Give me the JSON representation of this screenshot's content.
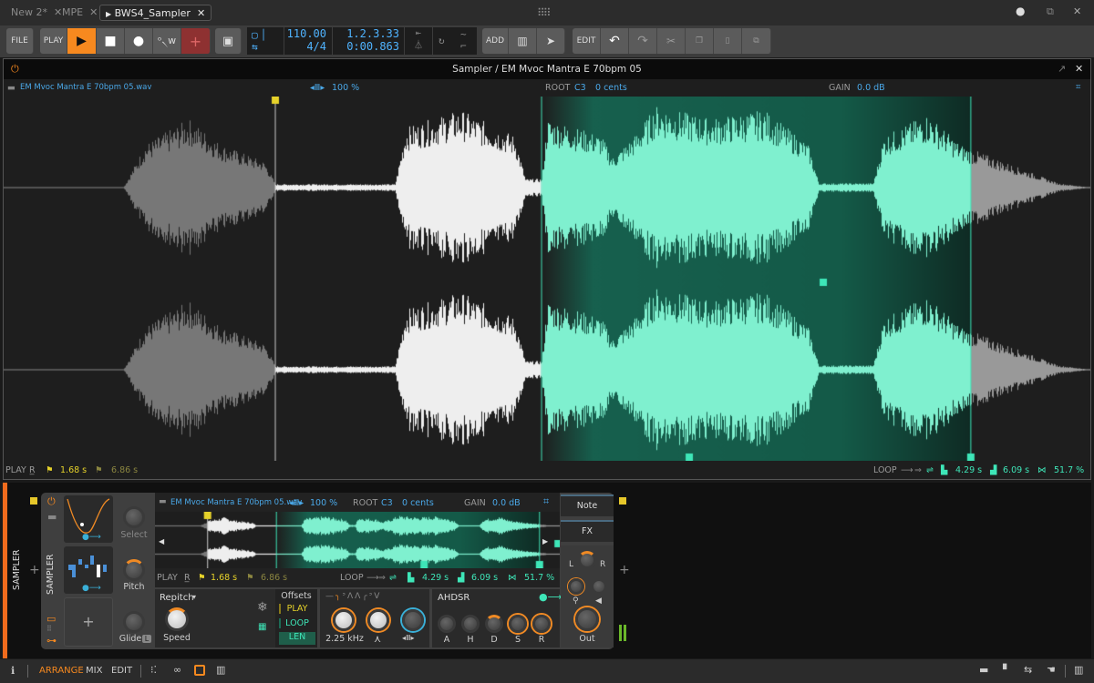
{
  "titlebar": {
    "tabs": [
      {
        "label": "New 2*"
      },
      {
        "label": "MPE"
      },
      {
        "label": "BWS4_Sampler"
      }
    ],
    "close": "✕"
  },
  "toolbar": {
    "file": "FILE",
    "play": "PLAY",
    "add": "ADD",
    "edit": "EDIT",
    "tempo": "110.00",
    "signature": "4/4",
    "position": "1.2.3.33",
    "time": "0:00.863"
  },
  "editor": {
    "title": "Sampler / EM Mvoc Mantra E 70bpm 05",
    "file": "EM Mvoc Mantra E 70bpm 05.wav",
    "speed": "100 %",
    "root_label": "ROOT",
    "root": "C3",
    "cents": "0 cents",
    "gain_label": "GAIN",
    "gain": "0.0 dB",
    "play_label": "PLAY",
    "play_start": "1.68 s",
    "play_end": "6.86 s",
    "loop_label": "LOOP",
    "loop_start": "4.29 s",
    "loop_end": "6.09 s",
    "crossfade": "51.7 %"
  },
  "device": {
    "track_label": "SAMPLER",
    "device_label": "SAMPLER",
    "file": "EM Mvoc Mantra E 70bpm 05.wav",
    "speed": "100 %",
    "root_label": "ROOT",
    "root": "C3",
    "cents": "0 cents",
    "gain_label": "GAIN",
    "gain": "0.0 dB",
    "play_label": "PLAY",
    "play_start": "1.68 s",
    "play_end": "6.86 s",
    "loop_label": "LOOP",
    "loop_start": "4.29 s",
    "loop_end": "6.09 s",
    "crossfade": "51.7 %",
    "select": "Select",
    "pitch": "Pitch",
    "glide": "Glide",
    "glide_badge": "L",
    "mode": "Repitch",
    "speed_knob": "Speed",
    "offsets": "Offsets",
    "off_play": "PLAY",
    "off_loop": "LOOP",
    "off_len": "LEN",
    "filter_freq": "2.25 kHz",
    "env": "AHDSR",
    "env_labels": [
      "A",
      "H",
      "D",
      "S",
      "R"
    ],
    "note": "Note",
    "fx": "FX",
    "pan_l": "L",
    "pan_r": "R",
    "out": "Out"
  },
  "bottombar": {
    "arrange": "ARRANGE",
    "mix": "MIX",
    "edit": "EDIT"
  },
  "colors": {
    "accent": "#f7891f",
    "teal": "#3ee6b8",
    "blue": "#4fb3ff",
    "yellow": "#e6d22a"
  }
}
